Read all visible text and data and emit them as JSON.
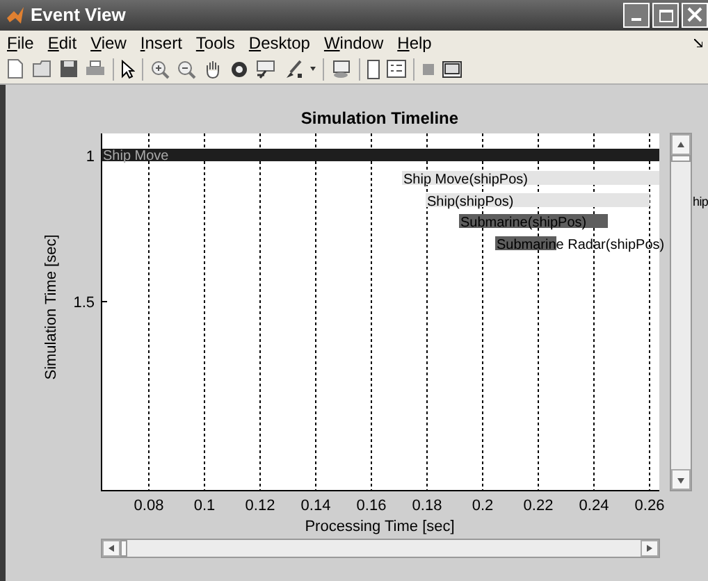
{
  "window": {
    "title": "Event View"
  },
  "menu": [
    "File",
    "Edit",
    "View",
    "Insert",
    "Tools",
    "Desktop",
    "Window",
    "Help"
  ],
  "figure": {
    "title": "Simulation Timeline",
    "xlabel": "Processing Time [sec]",
    "ylabel": "Simulation Time [sec]",
    "xticks": [
      "0.08",
      "0.1",
      "0.12",
      "0.14",
      "0.16",
      "0.18",
      "0.2",
      "0.22",
      "0.24",
      "0.26"
    ],
    "yticks": [
      "1",
      "1.5"
    ],
    "events": [
      {
        "label": "Ship Move",
        "kind": "dark"
      },
      {
        "label": "Ship Move(shipPos)",
        "kind": "light"
      },
      {
        "label": "Ship(shipPos)",
        "kind": "light"
      },
      {
        "label": "Submarine(shipPos)",
        "kind": "medium"
      },
      {
        "label": "Submarine Radar(shipPos)",
        "kind": "medium"
      }
    ],
    "overflow_label": "hip"
  }
}
